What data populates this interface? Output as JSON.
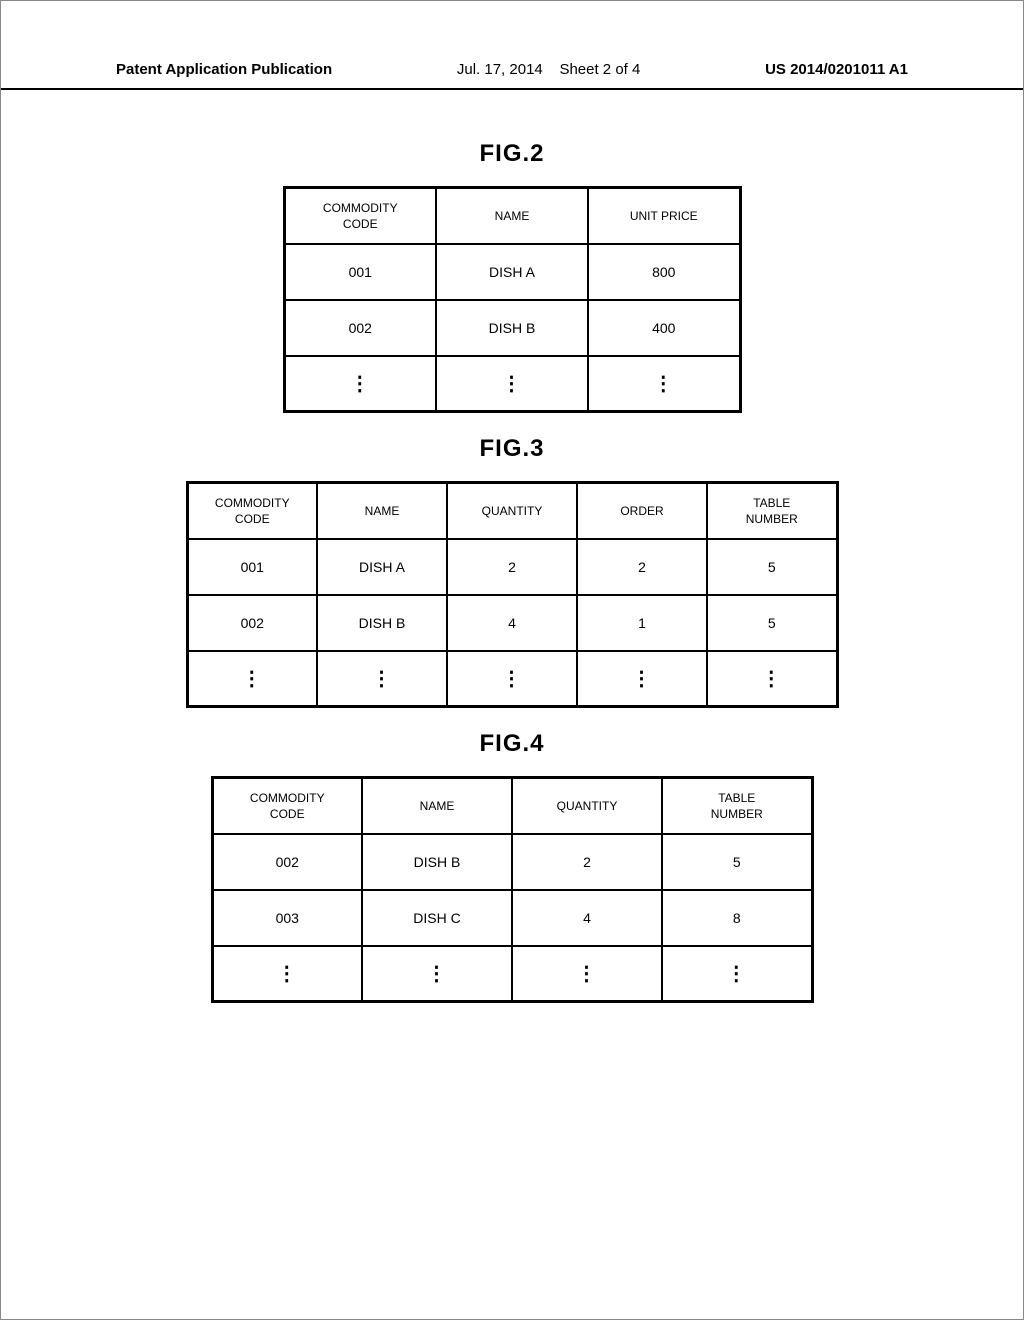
{
  "header": {
    "left": "Patent Application Publication",
    "date": "Jul. 17, 2014",
    "sheet": "Sheet 2 of 4",
    "pubno": "US 2014/0201011 A1"
  },
  "fig2": {
    "label": "FIG.2",
    "headers": [
      "COMMODITY\nCODE",
      "NAME",
      "UNIT PRICE"
    ],
    "rows": [
      [
        "001",
        "DISH A",
        "800"
      ],
      [
        "002",
        "DISH B",
        "400"
      ],
      [
        "⋮",
        "⋮",
        "⋮"
      ]
    ]
  },
  "fig3": {
    "label": "FIG.3",
    "headers": [
      "COMMODITY\nCODE",
      "NAME",
      "QUANTITY",
      "ORDER",
      "TABLE\nNUMBER"
    ],
    "rows": [
      [
        "001",
        "DISH A",
        "2",
        "2",
        "5"
      ],
      [
        "002",
        "DISH B",
        "4",
        "1",
        "5"
      ],
      [
        "⋮",
        "⋮",
        "⋮",
        "⋮",
        "⋮"
      ]
    ]
  },
  "fig4": {
    "label": "FIG.4",
    "headers": [
      "COMMODITY\nCODE",
      "NAME",
      "QUANTITY",
      "TABLE\nNUMBER"
    ],
    "rows": [
      [
        "002",
        "DISH B",
        "2",
        "5"
      ],
      [
        "003",
        "DISH C",
        "4",
        "8"
      ],
      [
        "⋮",
        "⋮",
        "⋮",
        "⋮"
      ]
    ]
  }
}
